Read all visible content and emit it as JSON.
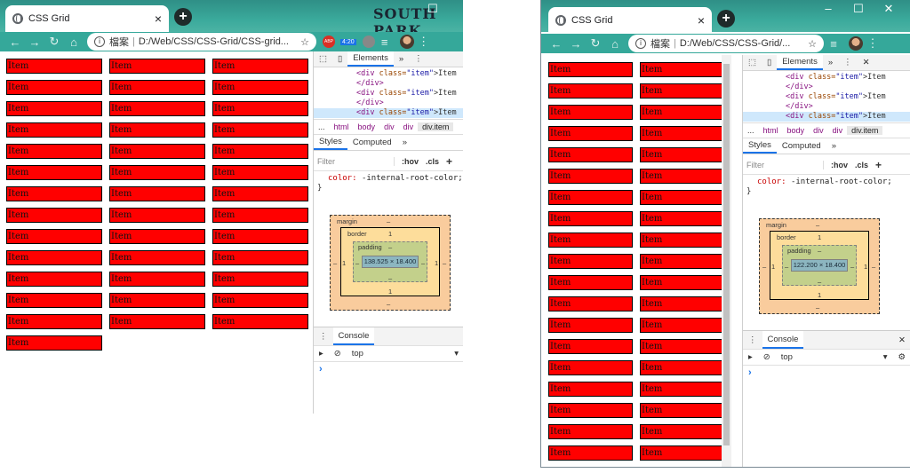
{
  "browser": {
    "tab_title": "CSS Grid",
    "tab_close": "×",
    "new_tab": "+",
    "brand_text": "SOUTH PARK",
    "window_controls": {
      "minimize": "–",
      "maximize": "☐",
      "close": "✕"
    },
    "nav": {
      "back": "←",
      "forward": "→",
      "reload": "↻",
      "home": "⌂"
    },
    "address_prefix": "檔案",
    "address_left": "D:/Web/CSS/CSS-Grid/CSS-grid...",
    "address_right": "D:/Web/CSS/CSS-Grid/...",
    "star": "☆",
    "menu": "⋮",
    "ext_abp": "ABP",
    "ext_timer": "4:20",
    "reading_list": "≡"
  },
  "page": {
    "item_label": "Item",
    "left_item_count": 40,
    "left_columns": 3,
    "right_visible_item_count": 40,
    "right_columns": 2
  },
  "devtools": {
    "tabs": {
      "elements": "Elements",
      "more": "»",
      "menu": "⋮",
      "close": "✕"
    },
    "dom_lines": [
      {
        "indent": 3,
        "tag_open": "<div",
        "attr": " class=",
        "val": "\"item\"",
        "tail": ">Item"
      },
      {
        "indent": 3,
        "close": "</div>"
      },
      {
        "indent": 3,
        "tag_open": "<div",
        "attr": " class=",
        "val": "\"item\"",
        "tail": ">Item"
      },
      {
        "indent": 3,
        "close": "</div>"
      },
      {
        "indent": 3,
        "tag_open": "<div",
        "attr": " class=",
        "val": "\"item\"",
        "tail": ">Item"
      }
    ],
    "breadcrumbs": [
      "html",
      "body",
      "div",
      "div",
      "div.item"
    ],
    "ellipsis": "...",
    "styles_tabs": {
      "styles": "Styles",
      "computed": "Computed",
      "more": "»"
    },
    "filter_placeholder": "Filter",
    "hov": ":hov",
    "cls": ".cls",
    "plus": "+",
    "rule_prop": "color:",
    "rule_value": "-internal-root-color;",
    "rule_close": "}",
    "box_model": {
      "margin_label": "margin",
      "border_label": "border",
      "padding_label": "padding",
      "dash": "–",
      "one": "1",
      "content_left": "138.525 × 18.400",
      "content_right": "122.200 × 18.400"
    },
    "console_label": "Console",
    "console_context": "top",
    "console_close": "✕",
    "prompt": "›"
  },
  "colors": {
    "item_bg": "#ff0000",
    "chrome_teal": "#35a89a",
    "accent": "#1a73e8"
  }
}
